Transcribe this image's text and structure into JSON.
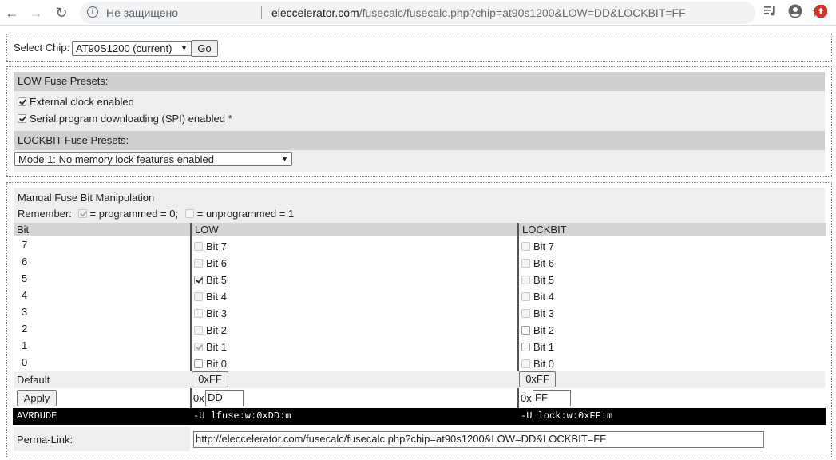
{
  "browser": {
    "back_glyph": "←",
    "forward_glyph": "→",
    "reload_glyph": "↻",
    "security_label": "Не защищено",
    "url_host": "eleccelerator.com",
    "url_rest": "/fusecalc/fusecalc.php?chip=at90s1200&LOW=DD&LOCKBIT=FF",
    "icons": [
      "back-icon",
      "forward-icon",
      "reload-icon",
      "info-icon",
      "star-icon",
      "media-icon",
      "profile-icon",
      "extension-icon"
    ]
  },
  "chip": {
    "label": "Select Chip:",
    "selected": "AT90S1200 (current)",
    "go_label": "Go"
  },
  "low_presets": {
    "title": "LOW Fuse Presets:",
    "items": [
      {
        "label": "External clock enabled",
        "checked": true
      },
      {
        "label": "Serial program downloading (SPI) enabled *",
        "checked": true
      }
    ]
  },
  "lock_presets": {
    "title": "LOCKBIT Fuse Presets:",
    "selected": "Mode 1: No memory lock features enabled"
  },
  "manual": {
    "title": "Manual Fuse Bit Manipulation",
    "remember_prefix": "Remember:",
    "programmed_text": "= programmed = 0;",
    "unprogrammed_text": "= unprogrammed = 1",
    "col_bit": "Bit",
    "col_low": "LOW",
    "col_lock": "LOCKBIT",
    "rows": [
      {
        "bit": "7",
        "low_label": "Bit 7",
        "low_checked": false,
        "low_enabled": false,
        "lock_label": "Bit 7",
        "lock_checked": false,
        "lock_enabled": false
      },
      {
        "bit": "6",
        "low_label": "Bit 6",
        "low_checked": false,
        "low_enabled": false,
        "lock_label": "Bit 6",
        "lock_checked": false,
        "lock_enabled": false
      },
      {
        "bit": "5",
        "low_label": "Bit 5",
        "low_checked": true,
        "low_enabled": true,
        "lock_label": "Bit 5",
        "lock_checked": false,
        "lock_enabled": false
      },
      {
        "bit": "4",
        "low_label": "Bit 4",
        "low_checked": false,
        "low_enabled": false,
        "lock_label": "Bit 4",
        "lock_checked": false,
        "lock_enabled": false
      },
      {
        "bit": "3",
        "low_label": "Bit 3",
        "low_checked": false,
        "low_enabled": false,
        "lock_label": "Bit 3",
        "lock_checked": false,
        "lock_enabled": false
      },
      {
        "bit": "2",
        "low_label": "Bit 2",
        "low_checked": false,
        "low_enabled": false,
        "lock_label": "Bit 2",
        "lock_checked": false,
        "lock_enabled": true
      },
      {
        "bit": "1",
        "low_label": "Bit 1",
        "low_checked": true,
        "low_enabled": false,
        "lock_label": "Bit 1",
        "lock_checked": false,
        "lock_enabled": true
      },
      {
        "bit": "0",
        "low_label": "Bit 0",
        "low_checked": false,
        "low_enabled": true,
        "lock_label": "Bit 0",
        "lock_checked": false,
        "lock_enabled": false
      }
    ],
    "default_label": "Default",
    "low_default": "0xFF",
    "lock_default": "0xFF",
    "apply_label": "Apply",
    "hex_prefix": "0x",
    "low_value": "DD",
    "lock_value": "FF",
    "avrdude_label": "AVRDUDE",
    "avrdude_low": "-U lfuse:w:0xDD:m",
    "avrdude_lock": "-U lock:w:0xFF:m",
    "permalink_label": "Perma-Link:",
    "permalink_value": "http://eleccelerator.com/fusecalc/fusecalc.php?chip=at90s1200&LOW=DD&LOCKBIT=FF"
  }
}
